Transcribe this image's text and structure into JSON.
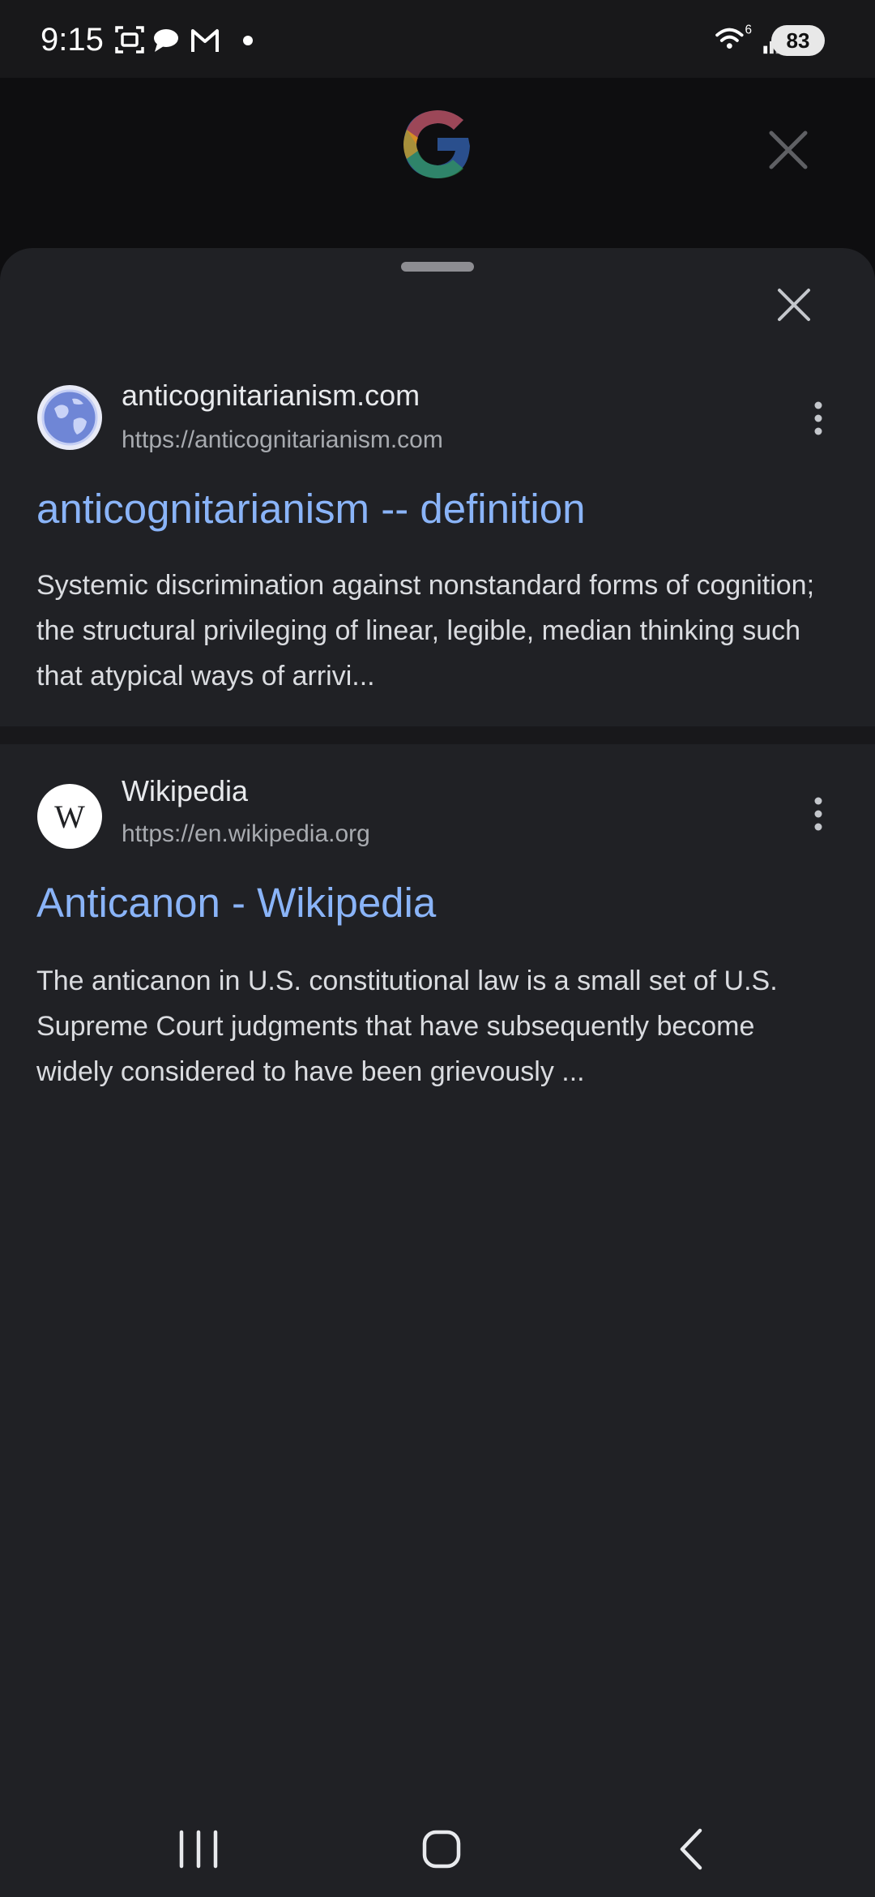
{
  "status_bar": {
    "time": "9:15",
    "left_icons": [
      "screenshot-icon",
      "chat-bubble-icon",
      "gmail-icon",
      "dot-icon"
    ],
    "wifi_label": "6",
    "battery": "83"
  },
  "header": {
    "logo": "google-g-logo",
    "close_icon": "close-icon"
  },
  "sheet": {
    "results": [
      {
        "site_name": "anticognitarianism.com",
        "url": "https://anticognitarianism.com",
        "title": "anticognitarianism -- definition",
        "snippet": "Systemic discrimination against nonstandard forms of cognition; the structural privileging of linear, legible, median thinking such that atypical ways of arrivi...",
        "favicon": "globe-icon"
      },
      {
        "site_name": "Wikipedia",
        "url": "https://en.wikipedia.org",
        "title": "Anticanon - Wikipedia",
        "snippet": "The anticanon in U.S. constitutional law is a small set of U.S. Supreme Court judgments that have subsequently become widely considered to have been grievously ...",
        "favicon": "wikipedia-w-icon",
        "favicon_letter": "W"
      }
    ]
  },
  "nav_bar": {
    "buttons": [
      "recent-apps-icon",
      "home-icon",
      "back-icon"
    ]
  },
  "colors": {
    "title_link": "#8ab4f8",
    "sheet_bg": "#202125",
    "page_bg": "#0e0e10"
  }
}
